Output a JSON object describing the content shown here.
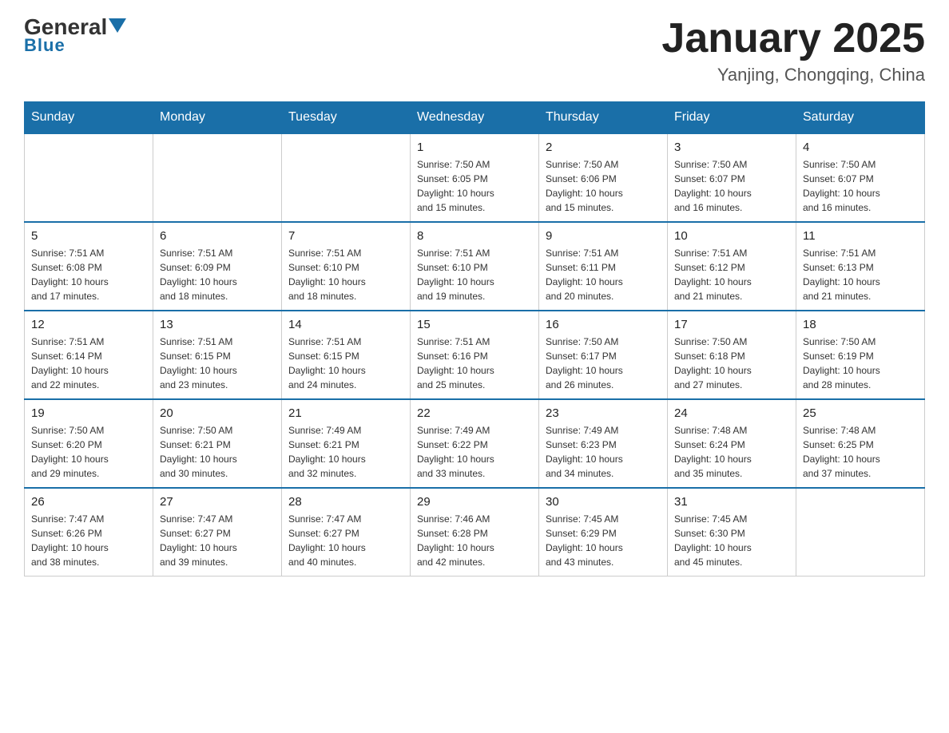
{
  "logo": {
    "general": "General",
    "blue": "Blue"
  },
  "header": {
    "title": "January 2025",
    "subtitle": "Yanjing, Chongqing, China"
  },
  "days_of_week": [
    "Sunday",
    "Monday",
    "Tuesday",
    "Wednesday",
    "Thursday",
    "Friday",
    "Saturday"
  ],
  "weeks": [
    [
      {
        "day": "",
        "info": ""
      },
      {
        "day": "",
        "info": ""
      },
      {
        "day": "",
        "info": ""
      },
      {
        "day": "1",
        "info": "Sunrise: 7:50 AM\nSunset: 6:05 PM\nDaylight: 10 hours\nand 15 minutes."
      },
      {
        "day": "2",
        "info": "Sunrise: 7:50 AM\nSunset: 6:06 PM\nDaylight: 10 hours\nand 15 minutes."
      },
      {
        "day": "3",
        "info": "Sunrise: 7:50 AM\nSunset: 6:07 PM\nDaylight: 10 hours\nand 16 minutes."
      },
      {
        "day": "4",
        "info": "Sunrise: 7:50 AM\nSunset: 6:07 PM\nDaylight: 10 hours\nand 16 minutes."
      }
    ],
    [
      {
        "day": "5",
        "info": "Sunrise: 7:51 AM\nSunset: 6:08 PM\nDaylight: 10 hours\nand 17 minutes."
      },
      {
        "day": "6",
        "info": "Sunrise: 7:51 AM\nSunset: 6:09 PM\nDaylight: 10 hours\nand 18 minutes."
      },
      {
        "day": "7",
        "info": "Sunrise: 7:51 AM\nSunset: 6:10 PM\nDaylight: 10 hours\nand 18 minutes."
      },
      {
        "day": "8",
        "info": "Sunrise: 7:51 AM\nSunset: 6:10 PM\nDaylight: 10 hours\nand 19 minutes."
      },
      {
        "day": "9",
        "info": "Sunrise: 7:51 AM\nSunset: 6:11 PM\nDaylight: 10 hours\nand 20 minutes."
      },
      {
        "day": "10",
        "info": "Sunrise: 7:51 AM\nSunset: 6:12 PM\nDaylight: 10 hours\nand 21 minutes."
      },
      {
        "day": "11",
        "info": "Sunrise: 7:51 AM\nSunset: 6:13 PM\nDaylight: 10 hours\nand 21 minutes."
      }
    ],
    [
      {
        "day": "12",
        "info": "Sunrise: 7:51 AM\nSunset: 6:14 PM\nDaylight: 10 hours\nand 22 minutes."
      },
      {
        "day": "13",
        "info": "Sunrise: 7:51 AM\nSunset: 6:15 PM\nDaylight: 10 hours\nand 23 minutes."
      },
      {
        "day": "14",
        "info": "Sunrise: 7:51 AM\nSunset: 6:15 PM\nDaylight: 10 hours\nand 24 minutes."
      },
      {
        "day": "15",
        "info": "Sunrise: 7:51 AM\nSunset: 6:16 PM\nDaylight: 10 hours\nand 25 minutes."
      },
      {
        "day": "16",
        "info": "Sunrise: 7:50 AM\nSunset: 6:17 PM\nDaylight: 10 hours\nand 26 minutes."
      },
      {
        "day": "17",
        "info": "Sunrise: 7:50 AM\nSunset: 6:18 PM\nDaylight: 10 hours\nand 27 minutes."
      },
      {
        "day": "18",
        "info": "Sunrise: 7:50 AM\nSunset: 6:19 PM\nDaylight: 10 hours\nand 28 minutes."
      }
    ],
    [
      {
        "day": "19",
        "info": "Sunrise: 7:50 AM\nSunset: 6:20 PM\nDaylight: 10 hours\nand 29 minutes."
      },
      {
        "day": "20",
        "info": "Sunrise: 7:50 AM\nSunset: 6:21 PM\nDaylight: 10 hours\nand 30 minutes."
      },
      {
        "day": "21",
        "info": "Sunrise: 7:49 AM\nSunset: 6:21 PM\nDaylight: 10 hours\nand 32 minutes."
      },
      {
        "day": "22",
        "info": "Sunrise: 7:49 AM\nSunset: 6:22 PM\nDaylight: 10 hours\nand 33 minutes."
      },
      {
        "day": "23",
        "info": "Sunrise: 7:49 AM\nSunset: 6:23 PM\nDaylight: 10 hours\nand 34 minutes."
      },
      {
        "day": "24",
        "info": "Sunrise: 7:48 AM\nSunset: 6:24 PM\nDaylight: 10 hours\nand 35 minutes."
      },
      {
        "day": "25",
        "info": "Sunrise: 7:48 AM\nSunset: 6:25 PM\nDaylight: 10 hours\nand 37 minutes."
      }
    ],
    [
      {
        "day": "26",
        "info": "Sunrise: 7:47 AM\nSunset: 6:26 PM\nDaylight: 10 hours\nand 38 minutes."
      },
      {
        "day": "27",
        "info": "Sunrise: 7:47 AM\nSunset: 6:27 PM\nDaylight: 10 hours\nand 39 minutes."
      },
      {
        "day": "28",
        "info": "Sunrise: 7:47 AM\nSunset: 6:27 PM\nDaylight: 10 hours\nand 40 minutes."
      },
      {
        "day": "29",
        "info": "Sunrise: 7:46 AM\nSunset: 6:28 PM\nDaylight: 10 hours\nand 42 minutes."
      },
      {
        "day": "30",
        "info": "Sunrise: 7:45 AM\nSunset: 6:29 PM\nDaylight: 10 hours\nand 43 minutes."
      },
      {
        "day": "31",
        "info": "Sunrise: 7:45 AM\nSunset: 6:30 PM\nDaylight: 10 hours\nand 45 minutes."
      },
      {
        "day": "",
        "info": ""
      }
    ]
  ]
}
